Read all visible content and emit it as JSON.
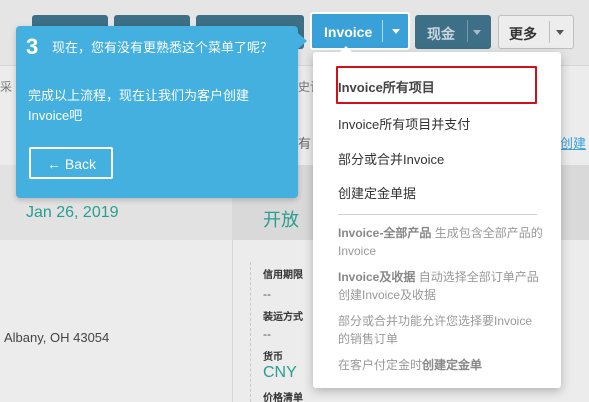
{
  "toolbar": {
    "invoice_label": "Invoice",
    "cash_label": "现金",
    "more_label": "更多"
  },
  "background": {
    "cut_left_text": "采",
    "cut_mid_text": "史记",
    "cut_mid2_text": "有",
    "cut_right_link": "创建",
    "date": "Jan 26, 2019",
    "status": "开放",
    "address": "Albany, OH 43054",
    "fields": {
      "credit_term_label": "信用期限",
      "credit_term_value": "--",
      "shipping_label": "装运方式",
      "shipping_value": "--",
      "currency_label": "货币",
      "currency_value": "CNY",
      "price_list_label": "价格清单"
    }
  },
  "tour": {
    "step": "3",
    "title": "现在，您有没有更熟悉这个菜单了呢？",
    "body": "完成以上流程，现在让我们为客户创建Invoice吧",
    "back_label": "← Back"
  },
  "menu": {
    "items": [
      {
        "label": "Invoice所有项目"
      },
      {
        "label": "Invoice所有项目并支付"
      },
      {
        "label": "部分或合并Invoice"
      },
      {
        "label": "创建定金单据"
      }
    ],
    "descriptions": {
      "d1_bold": "Invoice-全部产品",
      "d1_rest": " 生成包含全部产品的Invoice",
      "d2_bold": "Invoice及收据",
      "d2_rest": " 自动选择全部订单产品创建Invoice及收据",
      "d3": "部分或合并功能允许您选择要Invoice的销售订单",
      "d4_pre": "在客户付定金时",
      "d4_bold": "创建定金单"
    }
  },
  "colors": {
    "accent": "#3aa0d8",
    "tour_bg": "#43b0e0",
    "highlight": "#d0101b",
    "status_green": "#2a9d8f"
  }
}
